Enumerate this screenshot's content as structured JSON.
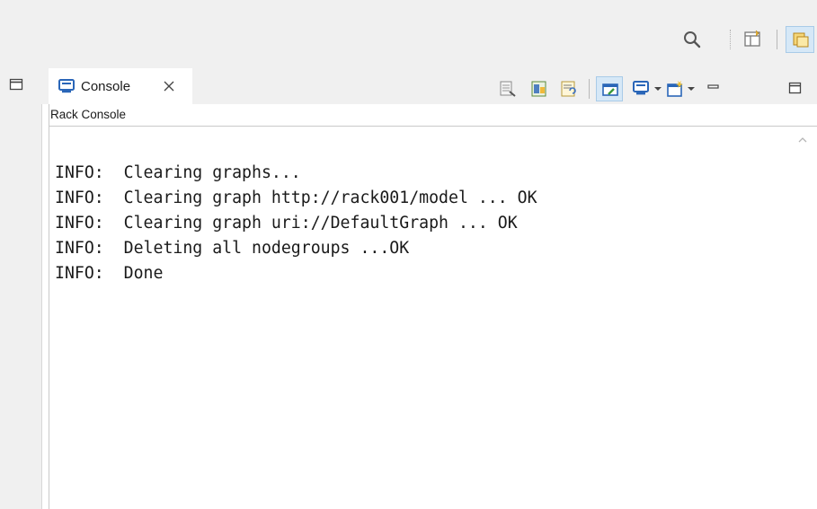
{
  "toolbar": {
    "icons": [
      "search-icon",
      "open-perspective-icon",
      "active-perspective-icon"
    ]
  },
  "left_strip": {
    "icons": [
      "restore-icon"
    ]
  },
  "view": {
    "tab": {
      "label": "Console",
      "icon": "console-icon",
      "close_icon": "close-icon"
    },
    "subtitle": "Rack Console",
    "toolbar_icons": [
      "clear-console-icon",
      "scroll-lock-icon",
      "word-wrap-icon",
      "pin-console-icon",
      "display-selected-console-icon",
      "open-console-icon",
      "minimize-icon",
      "maximize-icon"
    ],
    "console_lines": [
      "INFO:  Clearing graphs...",
      "INFO:  Clearing graph http://rack001/model ... OK",
      "INFO:  Clearing graph uri://DefaultGraph ... OK",
      "INFO:  Deleting all nodegroups ...OK",
      "INFO:  Done"
    ]
  },
  "colors": {
    "chrome_bg": "#f0f0f0",
    "active_highlight": "#d6e8f7",
    "console_text": "#1a1a1a"
  }
}
